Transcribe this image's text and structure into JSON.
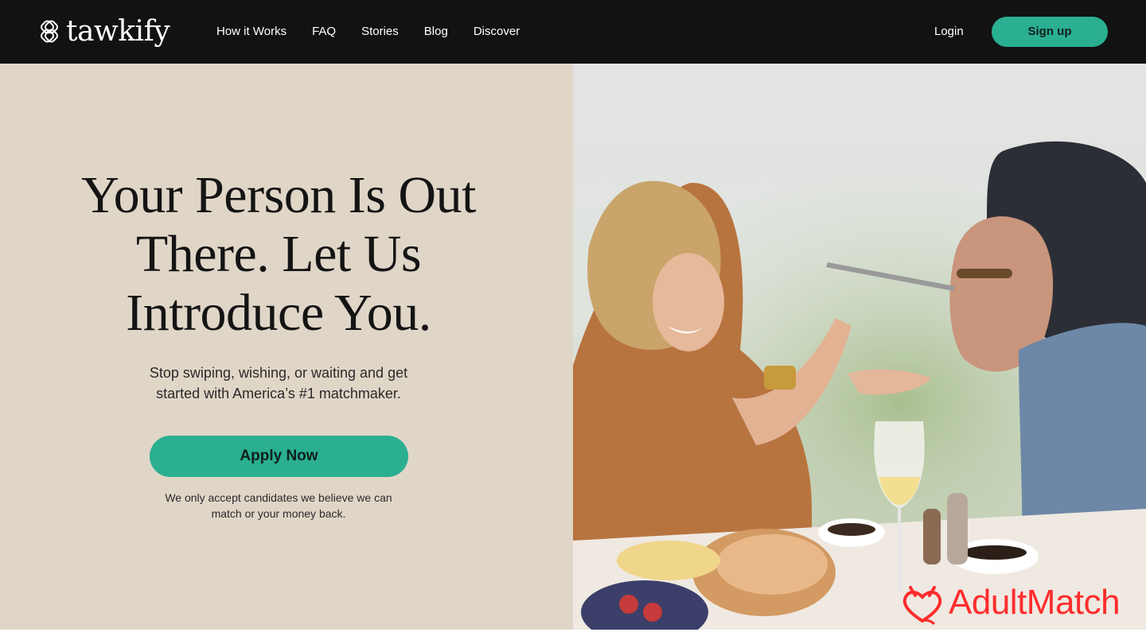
{
  "brand": {
    "name": "tawkify",
    "accent_color": "#2aaf91",
    "nav_bg": "#121212",
    "hero_bg": "#e0d6c8"
  },
  "nav": {
    "links": [
      {
        "label": "How it Works"
      },
      {
        "label": "FAQ"
      },
      {
        "label": "Stories"
      },
      {
        "label": "Blog"
      },
      {
        "label": "Discover"
      }
    ],
    "login_label": "Login",
    "signup_label": "Sign up"
  },
  "hero": {
    "title_lines": [
      "Your Person Is Out",
      "There. Let Us",
      "Introduce You."
    ],
    "subtitle_lines": [
      "Stop swiping, wishing, or waiting and get",
      "started with America’s #1 matchmaker."
    ],
    "cta_label": "Apply Now",
    "note_lines": [
      "We only accept candidates we believe we can",
      "match or your money back."
    ],
    "image": {
      "icon": "couple-dining-photo"
    }
  },
  "watermark": {
    "text": "AdultMatch",
    "icon": "devil-heart-icon",
    "color": "#ff2d2d"
  }
}
